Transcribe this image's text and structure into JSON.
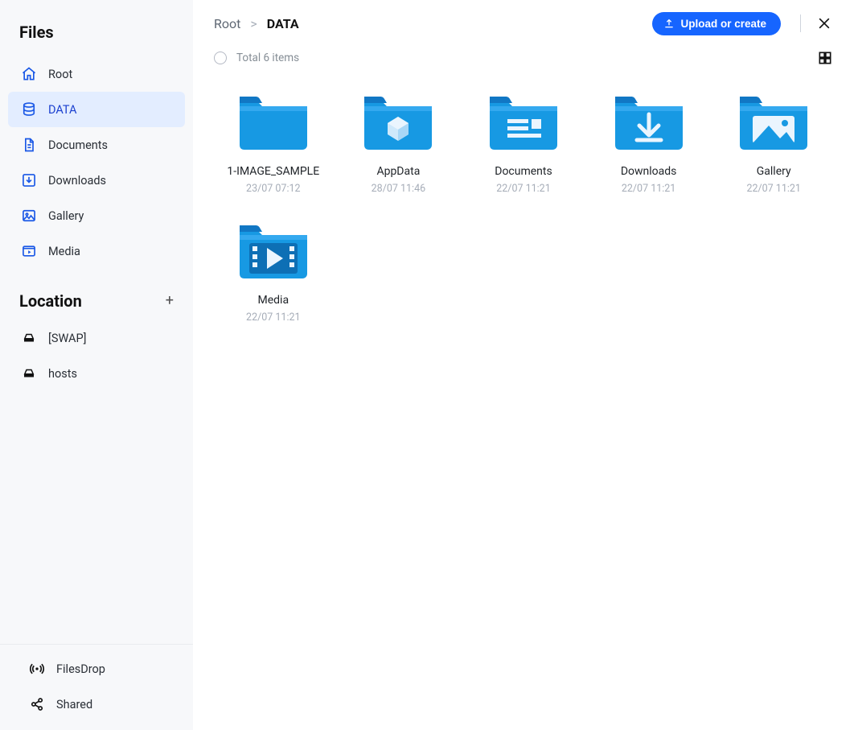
{
  "sidebar": {
    "title_files": "Files",
    "nav": [
      {
        "label": "Root",
        "icon": "home"
      },
      {
        "label": "DATA",
        "icon": "data",
        "active": true
      },
      {
        "label": "Documents",
        "icon": "doc"
      },
      {
        "label": "Downloads",
        "icon": "download-box"
      },
      {
        "label": "Gallery",
        "icon": "gallery-box"
      },
      {
        "label": "Media",
        "icon": "media-box"
      }
    ],
    "title_location": "Location",
    "locations": [
      {
        "label": "[SWAP]",
        "icon": "drive"
      },
      {
        "label": "hosts",
        "icon": "drive"
      }
    ],
    "footer": [
      {
        "label": "FilesDrop",
        "icon": "broadcast"
      },
      {
        "label": "Shared",
        "icon": "share"
      }
    ]
  },
  "breadcrumbs": {
    "parent": "Root",
    "sep": ">",
    "current": "DATA"
  },
  "toolbar": {
    "upload_label": "Upload or create"
  },
  "subbar": {
    "total_label": "Total 6 items"
  },
  "items": [
    {
      "name": "1-IMAGE_SAMPLE",
      "date": "23/07 07:12",
      "icon": "folder-plain"
    },
    {
      "name": "AppData",
      "date": "28/07 11:46",
      "icon": "folder-cube"
    },
    {
      "name": "Documents",
      "date": "22/07 11:21",
      "icon": "folder-doc"
    },
    {
      "name": "Downloads",
      "date": "22/07 11:21",
      "icon": "folder-download"
    },
    {
      "name": "Gallery",
      "date": "22/07 11:21",
      "icon": "folder-gallery"
    },
    {
      "name": "Media",
      "date": "22/07 11:21",
      "icon": "folder-media"
    }
  ]
}
